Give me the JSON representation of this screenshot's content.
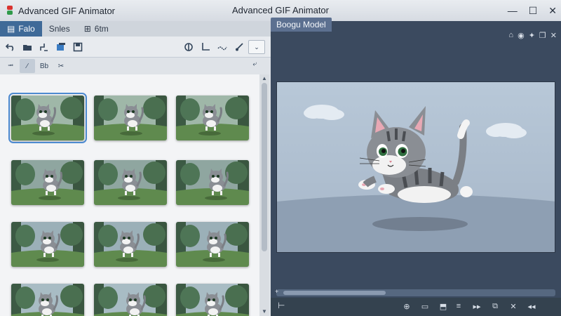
{
  "window": {
    "title": "Advanced GIF Animator",
    "center_title": "Advanced GIF Animator",
    "controls": [
      "—",
      "☐",
      "✕"
    ]
  },
  "left": {
    "tabs": [
      {
        "label": "Falo",
        "icon": "file-icon",
        "active": true
      },
      {
        "label": "Snles",
        "icon": "",
        "active": false
      },
      {
        "label": "6tm",
        "icon": "frames-icon",
        "active": false
      }
    ],
    "toolbar_icons": [
      "undo-icon",
      "folder-open-icon",
      "resize-icon",
      "layers-icon",
      "save-icon"
    ],
    "toolbar_right_icons": [
      "eye-icon",
      "crop-icon",
      "wave-icon",
      "brush-icon",
      "chevron-down-icon"
    ],
    "tool_row": [
      {
        "icon": "move-icon",
        "label": "⭲"
      },
      {
        "icon": "draw-icon",
        "label": "∕"
      },
      {
        "icon": "text-tool",
        "label": "Bb"
      },
      {
        "icon": "cut-icon",
        "label": "✂"
      }
    ],
    "frames_count_visible": 12
  },
  "right": {
    "model_tab": "Boogu Model",
    "toolbar_icons": [
      "home-icon",
      "compass-icon",
      "pin-icon",
      "float-icon",
      "close-icon"
    ],
    "bottom_left": "⊢",
    "bottom_icons_a": [
      "target-icon",
      "monitor-icon",
      "export-icon"
    ],
    "bottom_icons_b": [
      "menu-icon",
      "play-icon",
      "frames-icon",
      "cross-icon",
      "rewind-icon"
    ]
  },
  "colors": {
    "accent": "#3f6a98",
    "selection": "#4d8ad0",
    "dark_bg": "#3b4a5f"
  }
}
